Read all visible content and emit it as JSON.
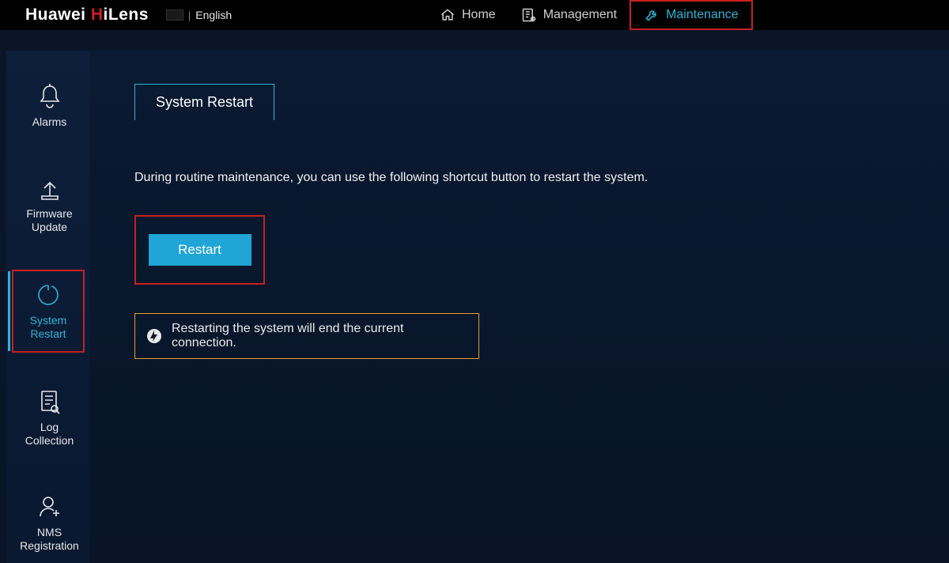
{
  "header": {
    "brand_prefix": "Huawei ",
    "brand_h": "H",
    "brand_suffix": "iLens",
    "language": "English",
    "nav": {
      "home": "Home",
      "management": "Management",
      "maintenance": "Maintenance"
    }
  },
  "sidebar": {
    "alarms": "Alarms",
    "firmware_update": "Firmware\nUpdate",
    "system_restart": "System\nRestart",
    "log_collection": "Log Collection",
    "nms_registration": "NMS\nRegistration"
  },
  "main": {
    "tab_label": "System Restart",
    "description": "During routine maintenance, you can use the following shortcut button to restart the system.",
    "restart_button": "Restart",
    "warning": "Restarting the system will end the current connection."
  }
}
